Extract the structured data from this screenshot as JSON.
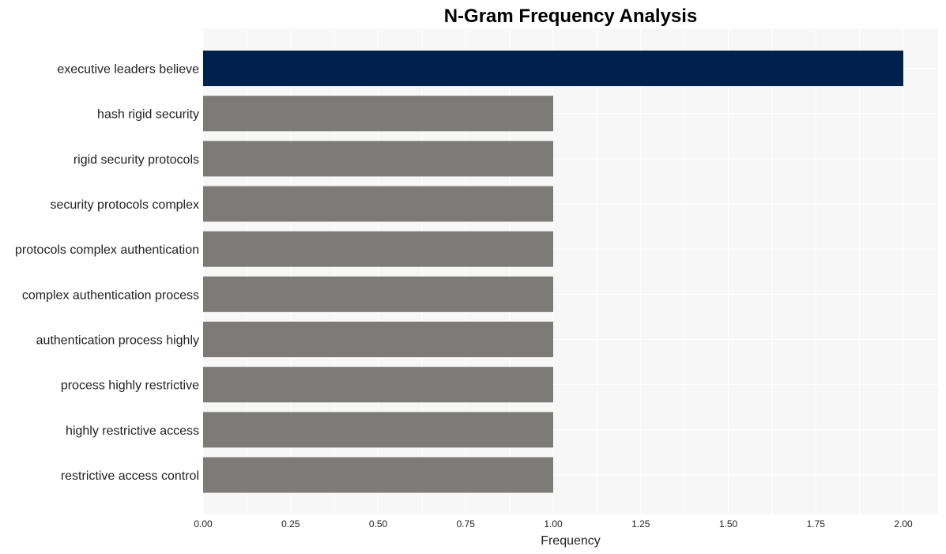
{
  "chart_data": {
    "type": "bar",
    "orientation": "horizontal",
    "title": "N-Gram Frequency Analysis",
    "xlabel": "Frequency",
    "ylabel": "",
    "xlim": [
      0,
      2.1
    ],
    "xticks": [
      "0.00",
      "0.25",
      "0.50",
      "0.75",
      "1.00",
      "1.25",
      "1.50",
      "1.75",
      "2.00"
    ],
    "grid": true,
    "categories": [
      "executive leaders believe",
      "hash rigid security",
      "rigid security protocols",
      "security protocols complex",
      "protocols complex authentication",
      "complex authentication process",
      "authentication process highly",
      "process highly restrictive",
      "highly restrictive access",
      "restrictive access control"
    ],
    "values": [
      2,
      1,
      1,
      1,
      1,
      1,
      1,
      1,
      1,
      1
    ],
    "colors": {
      "highlight": "#00204e",
      "default": "#7c7b77",
      "plot_background": "#f7f7f7",
      "grid": "#ffffff"
    }
  }
}
